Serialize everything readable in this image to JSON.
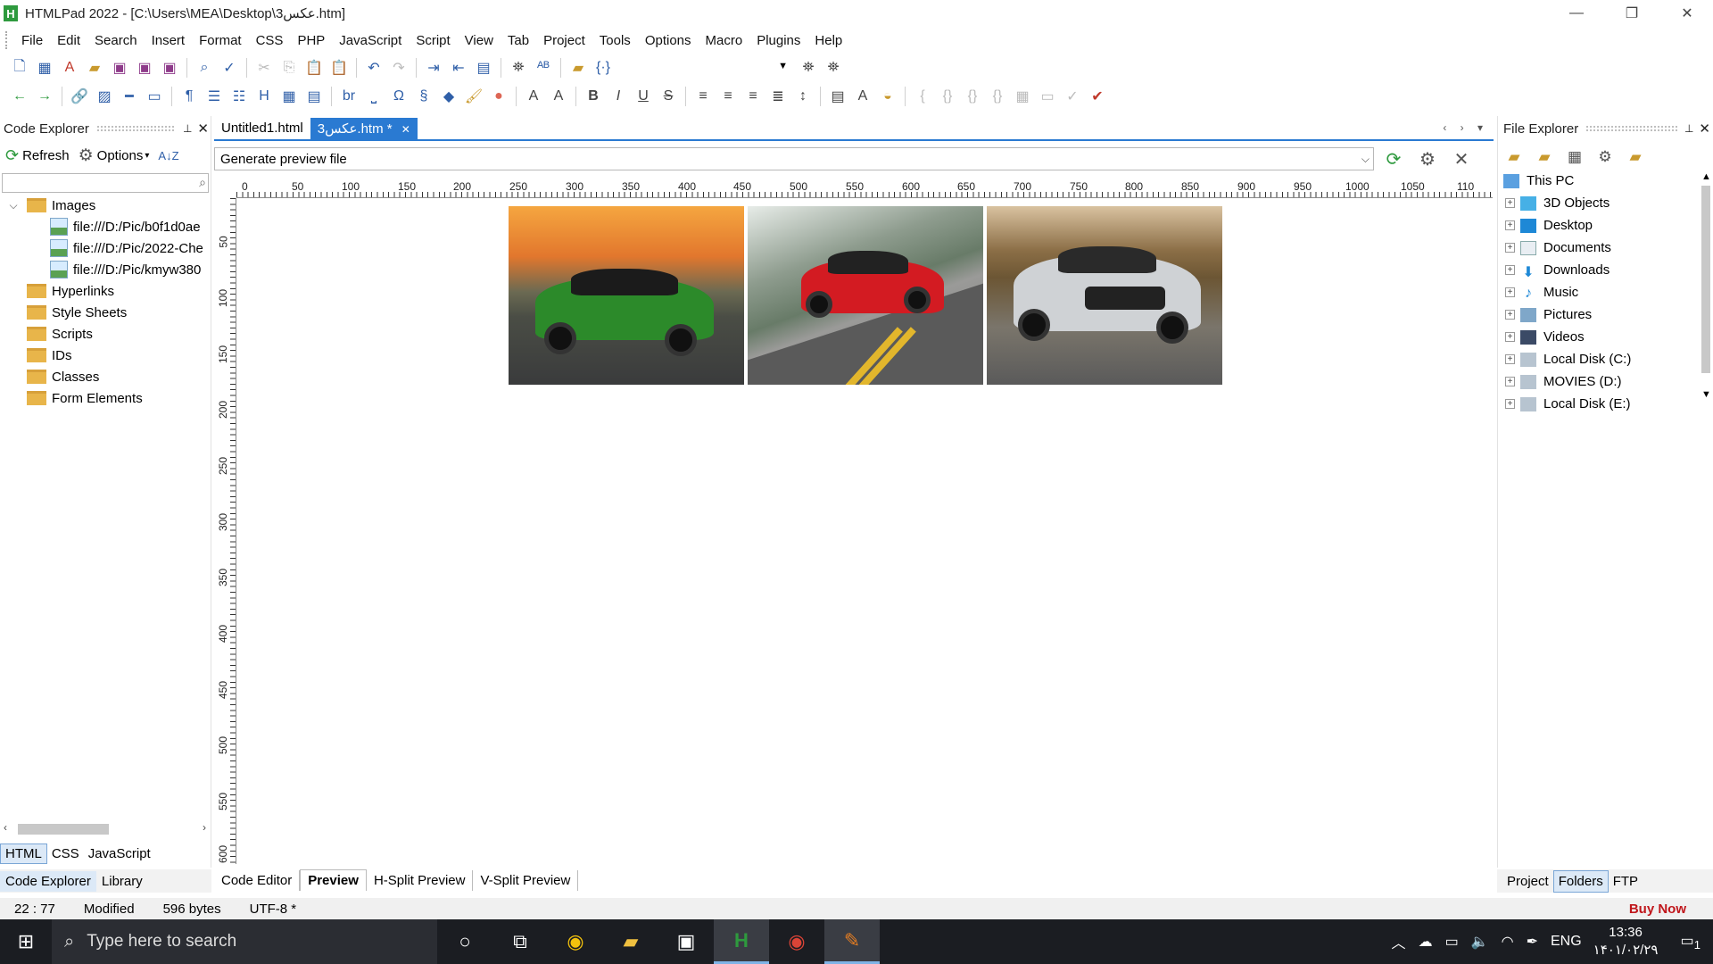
{
  "window": {
    "title": "HTMLPad 2022 - [C:\\Users\\MEA\\Desktop\\عکس3.htm]",
    "logo_letter": "H",
    "minimize": "—",
    "restore": "❐",
    "close": "✕"
  },
  "menu": [
    "File",
    "Edit",
    "Search",
    "Insert",
    "Format",
    "CSS",
    "PHP",
    "JavaScript",
    "Script",
    "View",
    "Tab",
    "Project",
    "Tools",
    "Options",
    "Macro",
    "Plugins",
    "Help"
  ],
  "toolbar2_text": {
    "br": "br",
    "heading": "H"
  },
  "code_explorer": {
    "title": "Code Explorer",
    "pin": "📌",
    "close": "✕",
    "refresh": "Refresh",
    "options": "Options",
    "sort": "A↓Z",
    "tree": [
      {
        "label": "Images",
        "expanded": true
      },
      {
        "label": "file:///D:/Pic/b0f1d0ae",
        "child": true
      },
      {
        "label": "file:///D:/Pic/2022-Che",
        "child": true
      },
      {
        "label": "file:///D:/Pic/kmyw380",
        "child": true
      },
      {
        "label": "Hyperlinks"
      },
      {
        "label": "Style Sheets"
      },
      {
        "label": "Scripts"
      },
      {
        "label": "IDs"
      },
      {
        "label": "Classes"
      },
      {
        "label": "Form Elements"
      }
    ],
    "lang_tabs": [
      "HTML",
      "CSS",
      "JavaScript"
    ],
    "bottom_tabs": [
      "Code Explorer",
      "Library"
    ]
  },
  "doc_tabs": [
    {
      "label": "Untitled1.html",
      "active": false
    },
    {
      "label": "عکس3.htm *",
      "active": true
    }
  ],
  "doc_tab_close": "✕",
  "preview": {
    "combo_value": "Generate preview file",
    "ruler_h": [
      "0",
      "50",
      "100",
      "150",
      "200",
      "250",
      "300",
      "350",
      "400",
      "450",
      "500",
      "550",
      "600",
      "650",
      "700",
      "750",
      "800",
      "850",
      "900",
      "950",
      "1000",
      "1050",
      "110"
    ],
    "ruler_v": [
      "50",
      "100",
      "150",
      "200",
      "250",
      "300",
      "350",
      "400",
      "450",
      "500",
      "550",
      "600"
    ]
  },
  "view_tabs": [
    {
      "label": "Code Editor",
      "active": false
    },
    {
      "label": "Preview",
      "active": true
    },
    {
      "label": "H-Split Preview",
      "active": false
    },
    {
      "label": "V-Split Preview",
      "active": false
    }
  ],
  "file_explorer": {
    "title": "File Explorer",
    "close": "✕",
    "root": "This PC",
    "items": [
      "3D Objects",
      "Desktop",
      "Documents",
      "Downloads",
      "Music",
      "Pictures",
      "Videos",
      "Local Disk (C:)",
      "MOVIES (D:)",
      "Local Disk (E:)"
    ],
    "bottom_tabs": [
      {
        "label": "Project",
        "active": false
      },
      {
        "label": "Folders",
        "active": true
      },
      {
        "label": "FTP",
        "active": false
      }
    ]
  },
  "status": {
    "position": "22 : 77",
    "state": "Modified",
    "size": "596 bytes",
    "encoding": "UTF-8 *",
    "buy_now": "Buy Now"
  },
  "taskbar": {
    "search_placeholder": "Type here to search",
    "language": "ENG",
    "time": "13:36",
    "date": "۱۴۰۱/۰۲/۲۹",
    "notification_count": "1"
  }
}
